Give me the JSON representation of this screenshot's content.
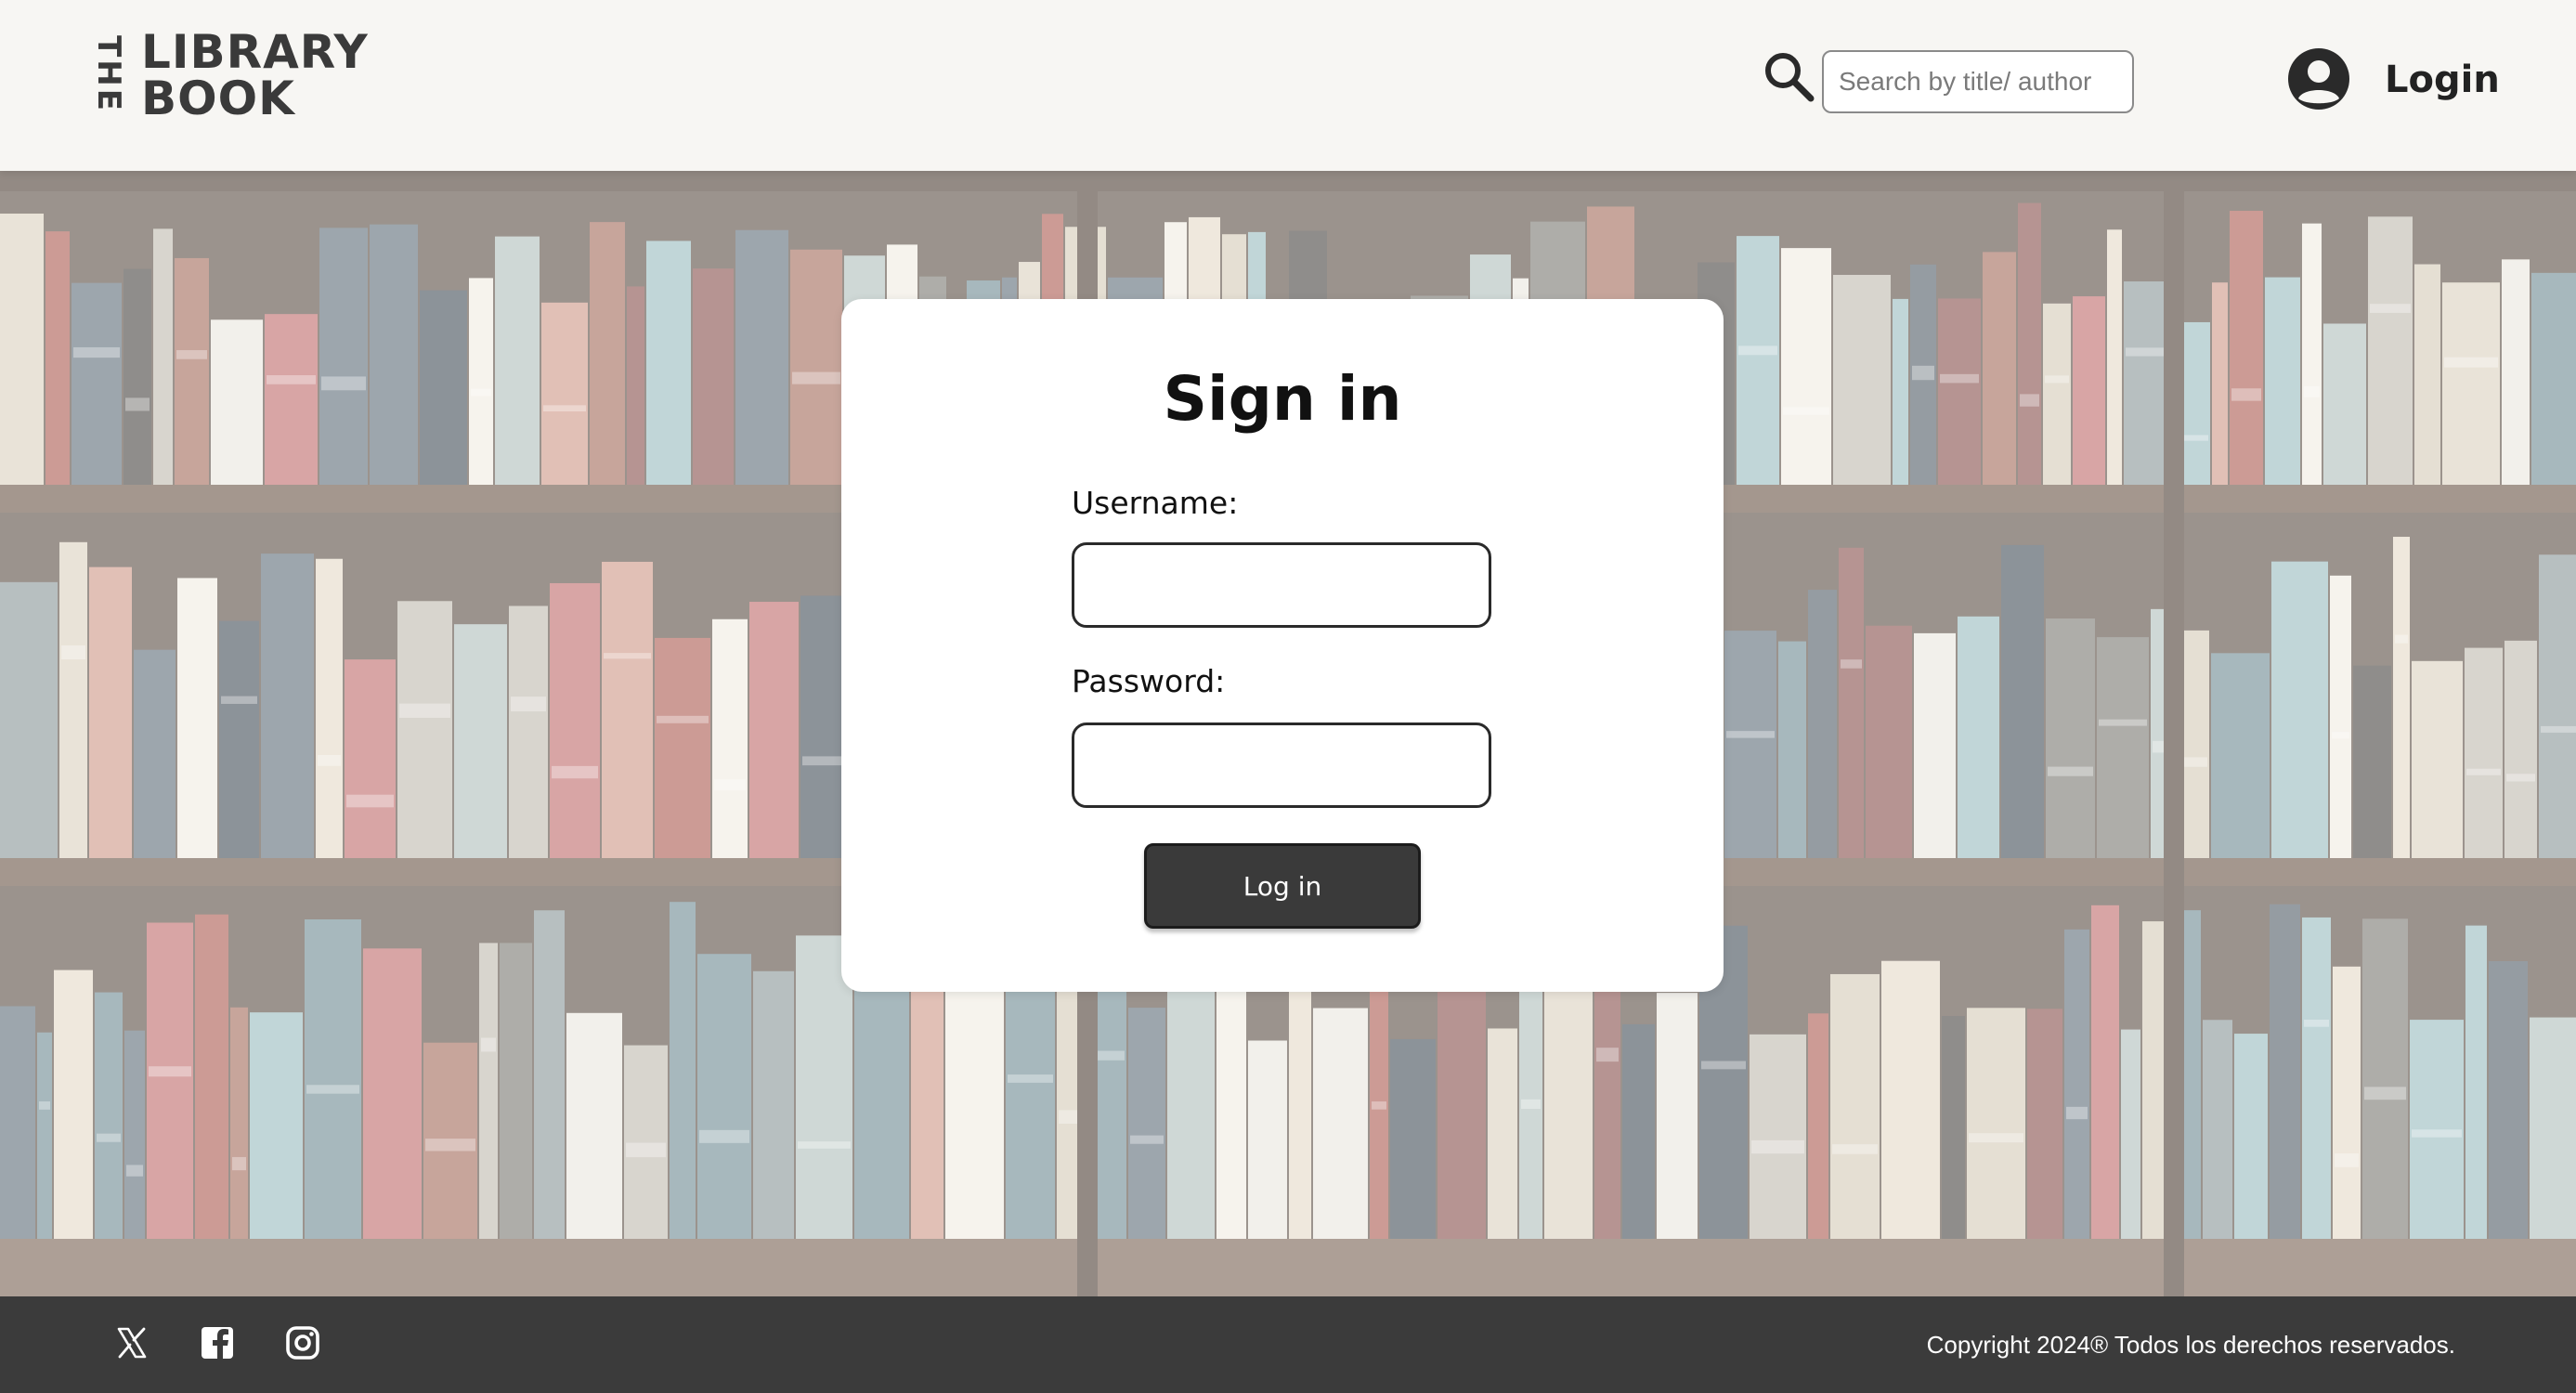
{
  "header": {
    "logo": {
      "line1": "THE",
      "line2": "LIBRARY",
      "line3": "BOOK"
    },
    "search": {
      "placeholder": "Search by title/ author",
      "value": ""
    },
    "login_label": "Login",
    "icons": {
      "search": "search-icon",
      "user": "user-circle-icon"
    }
  },
  "hero": {
    "background": "bookshelf-photo"
  },
  "signin": {
    "title": "Sign in",
    "username_label": "Username:",
    "username_value": "",
    "password_label": "Password:",
    "password_value": "",
    "submit_label": "Log in"
  },
  "footer": {
    "social": [
      "x-icon",
      "facebook-icon",
      "instagram-icon"
    ],
    "copyright": "Copyright 2024® Todos los derechos reservados."
  },
  "colors": {
    "header_bg": "#f7f6f3",
    "footer_bg": "#3b3b3b",
    "button_bg": "#3a3a3a",
    "text_dark": "#222222"
  }
}
